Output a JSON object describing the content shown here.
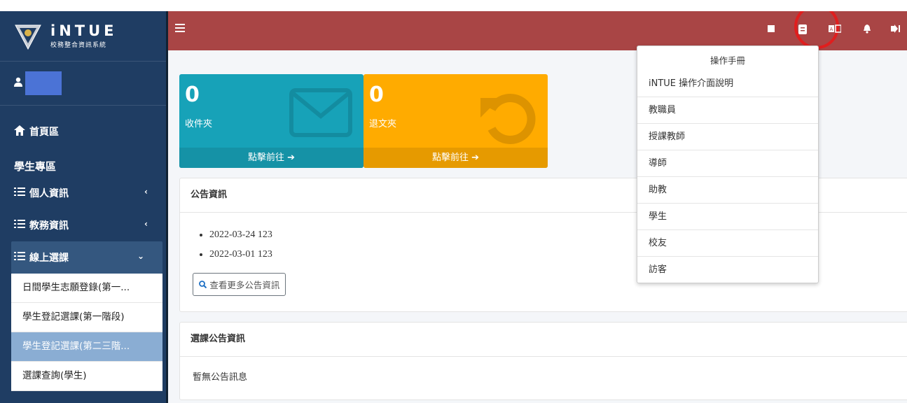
{
  "brand": {
    "name": "iNTUE",
    "subtitle": "校務整合資訊系統"
  },
  "sidebar": {
    "home_label": "首頁區",
    "section_title": "學生專區",
    "menus": [
      {
        "label": "個人資訊",
        "chevron": "‹"
      },
      {
        "label": "教務資訊",
        "chevron": "‹"
      },
      {
        "label": "線上選課",
        "chevron": "⌄"
      }
    ],
    "sub_items": [
      "日間學生志願登錄(第一...",
      "學生登記選課(第一階段)",
      "學生登記選課(第二三階...",
      "選課查詢(學生)"
    ],
    "active_sub_index": 2
  },
  "topbar": {
    "icons": [
      "square-icon",
      "manual-icon",
      "translate-icon",
      "bell-icon",
      "logout-icon"
    ]
  },
  "cards": [
    {
      "count": "0",
      "label": "收件夾",
      "footer": "點擊前往 ➔",
      "color": "#17a2b8",
      "footer_color": "#1592a6"
    },
    {
      "count": "0",
      "label": "退文夾",
      "footer": "點擊前往 ➔",
      "color": "#ffab00",
      "footer_color": "#e69a00"
    }
  ],
  "announcements": {
    "title": "公告資訊",
    "items": [
      "2022-03-24 123",
      "2022-03-01 123"
    ],
    "more_button": "查看更多公告資訊"
  },
  "course_announcements": {
    "title": "選課公告資訊",
    "empty_text": "暫無公告訊息"
  },
  "manual_dropdown": {
    "header": "操作手冊",
    "items": [
      "iNTUE 操作介面說明",
      "教職員",
      "授課教師",
      "導師",
      "助教",
      "學生",
      "校友",
      "訪客"
    ]
  },
  "colors": {
    "topbar": "#a94545",
    "sidebar": "#1f3d63",
    "highlight_circle": "#e01e1e"
  }
}
